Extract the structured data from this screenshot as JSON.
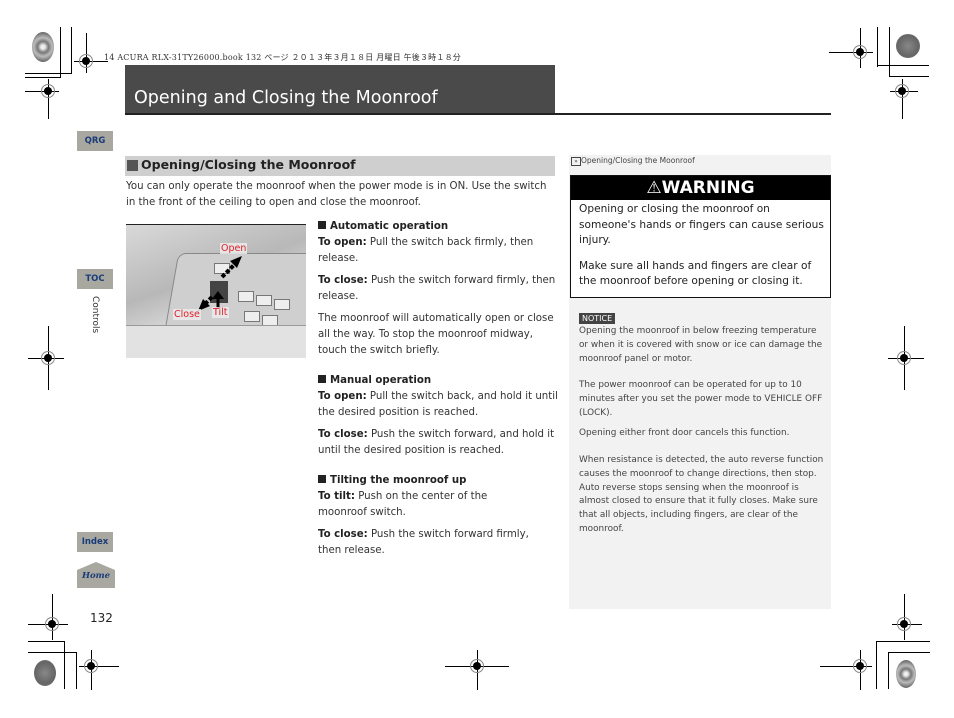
{
  "print_header": "14 ACURA RLX-31TY26000.book  132 ページ  ２０１３年３月１８日  月曜日  午後３時１８分",
  "page_title": "Opening and Closing the Moonroof",
  "nav": {
    "qrg": "QRG",
    "toc": "TOC",
    "index": "Index",
    "home": "Home",
    "section_label": "Controls"
  },
  "page_number": "132",
  "section": {
    "title": "Opening/Closing the Moonroof",
    "intro": "You can only operate the moonroof when the power mode is in ON. Use the switch in the front of the ceiling to open and close the moonroof."
  },
  "illustration": {
    "labels": {
      "open": "Open",
      "close": "Close",
      "tilt": "Tilt"
    },
    "label_color": "#e0202a"
  },
  "automatic": {
    "heading": "Automatic operation",
    "open_label": "To open:",
    "open_text": " Pull the switch back firmly, then release.",
    "close_label": "To close:",
    "close_text": " Push the switch forward firmly, then release.",
    "note": "The moonroof will automatically open or close all the way. To stop the moonroof midway, touch the switch briefly."
  },
  "manual": {
    "heading": "Manual operation",
    "open_label": "To open:",
    "open_text": " Pull the switch back, and hold it until the desired position is reached.",
    "close_label": "To close:",
    "close_text": " Push the switch forward, and hold it until the desired position is reached."
  },
  "tilting": {
    "heading": "Tilting the moonroof up",
    "tilt_label": "To tilt:",
    "tilt_text": " Push on the center of the moonroof switch.",
    "close_label": "To close:",
    "close_text": " Push the switch forward firmly, then release."
  },
  "sidebar": {
    "crumb": "Opening/Closing the Moonroof",
    "warning": {
      "title": "WARNING",
      "text1": "Opening or closing the moonroof on someone's hands or fingers can cause serious injury.",
      "text2": "Make sure all hands and fingers are clear of the moonroof before opening or closing it."
    },
    "notice": {
      "badge": "NOTICE",
      "text": "Opening the moonroof in below freezing temperature or when it is covered with snow or ice can damage the moonroof panel or motor."
    },
    "para1": "The power moonroof can be operated for up to 10 minutes after you set the power mode to VEHICLE OFF (LOCK).",
    "para2": "Opening either front door cancels this function.",
    "para3": "When resistance is detected, the auto reverse function causes the moonroof to change directions, then stop. Auto reverse stops sensing when the moonroof is almost closed to ensure that it fully closes. Make sure that all objects, including fingers, are clear of the moonroof."
  }
}
